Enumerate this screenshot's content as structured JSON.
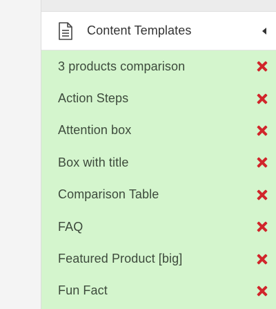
{
  "panel": {
    "header": {
      "title": "Content Templates",
      "icon": "document-icon",
      "caret_icon": "caret-left-icon"
    },
    "items": [
      {
        "label": "3 products comparison"
      },
      {
        "label": "Action Steps"
      },
      {
        "label": "Attention box"
      },
      {
        "label": "Box with title"
      },
      {
        "label": "Comparison Table"
      },
      {
        "label": "FAQ"
      },
      {
        "label": "Featured Product [big]"
      },
      {
        "label": "Fun Fact"
      }
    ],
    "delete_icon": "close-x-icon"
  },
  "colors": {
    "list_background": "#d4f5cd",
    "delete_red": "#d0262b",
    "header_background": "#ffffff"
  }
}
